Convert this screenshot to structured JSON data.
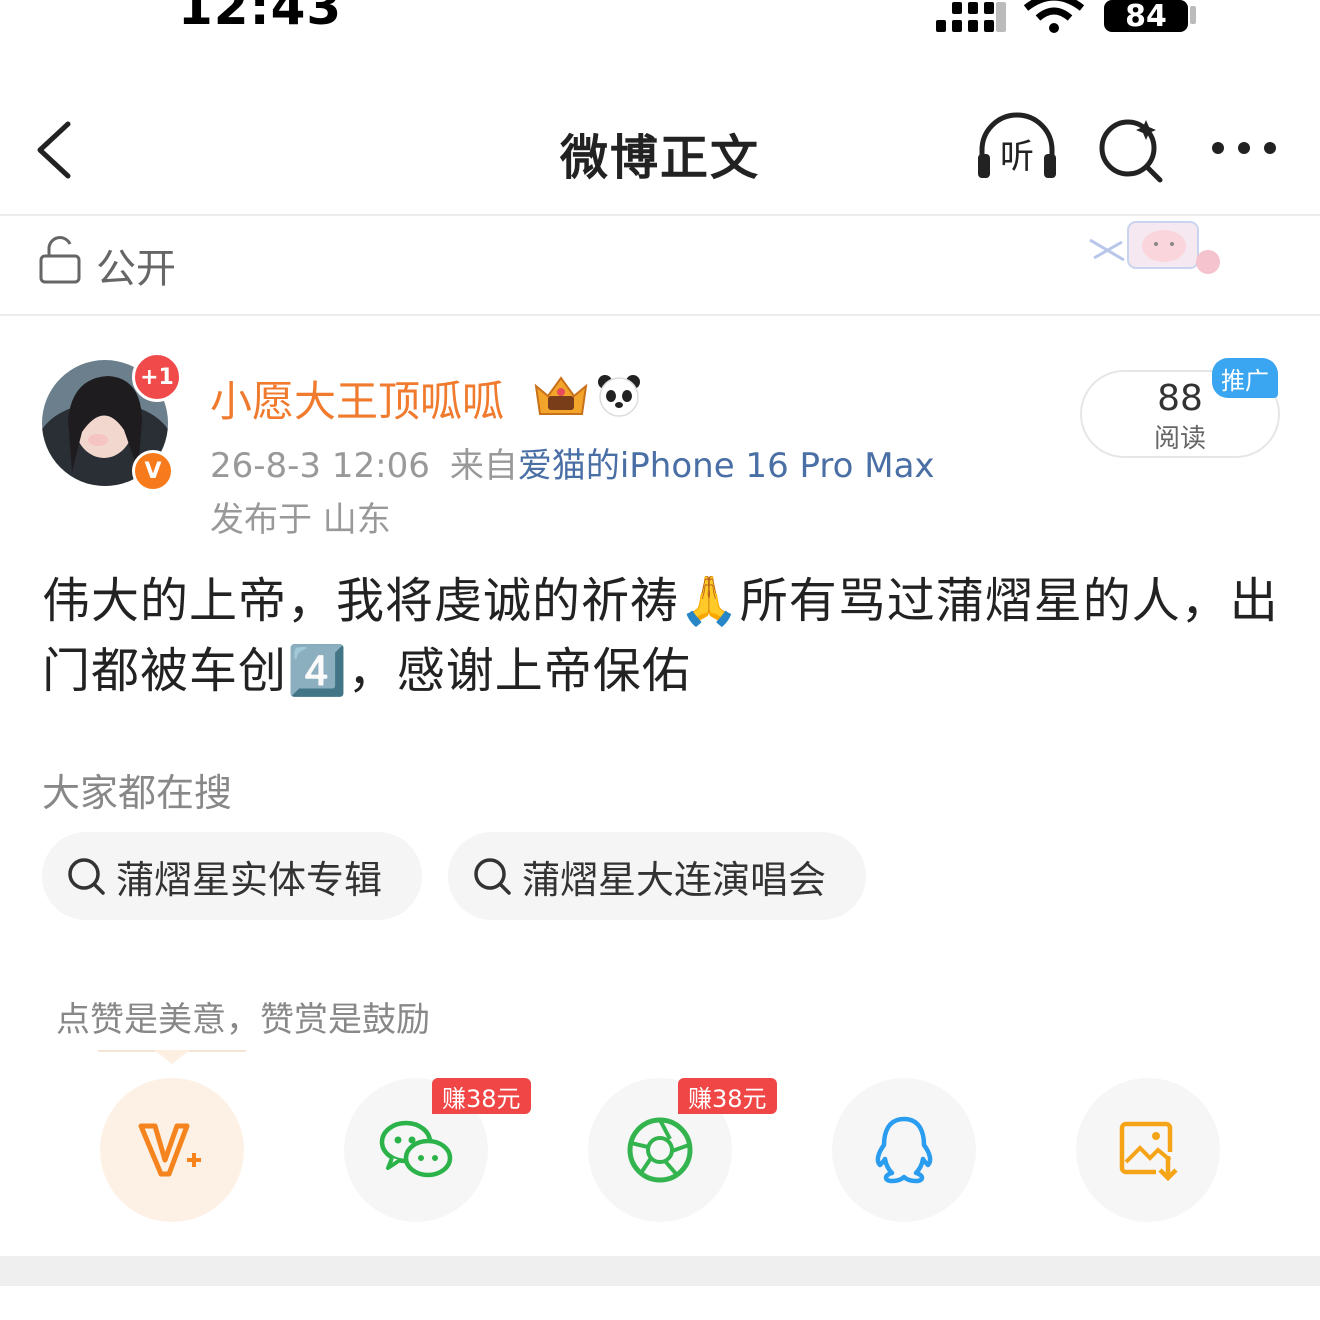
{
  "status_bar": {
    "time": "12:43",
    "battery": "84"
  },
  "nav": {
    "title": "微博正文"
  },
  "visibility": {
    "label": "公开"
  },
  "author": {
    "name": "小愿大王顶呱呱",
    "plus_badge": "+1",
    "verified_badge": "V",
    "date": "26-8-3 12:06",
    "from_label": "来自",
    "device": "爱猫的iPhone 16 Pro Max",
    "location": "发布于 山东"
  },
  "read_stats": {
    "count": "88",
    "label": "阅读",
    "promo_tag": "推广"
  },
  "post": {
    "text": "伟大的上帝，我将虔诚的祈祷🙏所有骂过蒲熠星的人，出门都被车创4️⃣，感谢上帝保佑"
  },
  "search_section": {
    "heading": "大家都在搜",
    "chips": [
      {
        "label": "蒲熠星实体专辑"
      },
      {
        "label": "蒲熠星大连演唱会"
      }
    ]
  },
  "tip": {
    "text": "点赞是美意，赞赏是鼓励"
  },
  "share": {
    "earn_badge_1": "赚38元",
    "earn_badge_2": "赚38元"
  },
  "colors": {
    "username": "#f07a2d",
    "device_link": "#4a6fa5",
    "promo": "#3aa6f2",
    "earn_badge": "#f04646",
    "wechat_green": "#2bb34a",
    "qq_blue": "#2a9df0",
    "save_orange": "#f5a418"
  }
}
